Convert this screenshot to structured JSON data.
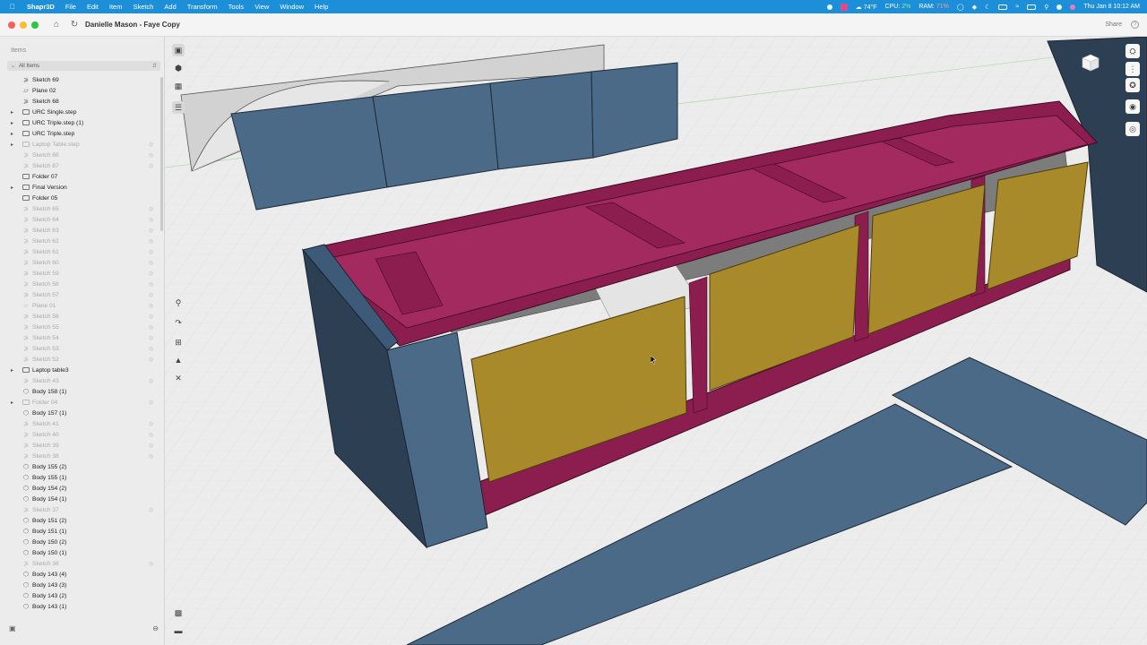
{
  "menubar": {
    "app_name": "Shapr3D",
    "menus": [
      "File",
      "Edit",
      "Item",
      "Sketch",
      "Add",
      "Transform",
      "Tools",
      "View",
      "Window",
      "Help"
    ],
    "weather": "74°F",
    "cpu_label": "CPU:",
    "ram_label": "RAM:",
    "cpu_value": "2%",
    "ram_value": "71%",
    "datetime": "Thu Jan 8  10:12 AM"
  },
  "titlebar": {
    "document": "Danielle Mason - Faye Copy",
    "share_label": "Share",
    "help_label": "?"
  },
  "sidebar": {
    "header": "Items",
    "all_items": "All Items",
    "items": [
      {
        "label": "Sketch 69",
        "kind": "sketch",
        "hidden": false,
        "expandable": false
      },
      {
        "label": "Plane 02",
        "kind": "plane",
        "hidden": false,
        "expandable": false
      },
      {
        "label": "Sketch 68",
        "kind": "sketch",
        "hidden": false,
        "expandable": false
      },
      {
        "label": "URC Single.step",
        "kind": "folder",
        "hidden": false,
        "expandable": true
      },
      {
        "label": "URC Triple.step (1)",
        "kind": "folder",
        "hidden": false,
        "expandable": true
      },
      {
        "label": "URC Triple.step",
        "kind": "folder",
        "hidden": false,
        "expandable": true
      },
      {
        "label": "Laptop Table.step",
        "kind": "folder",
        "hidden": true,
        "expandable": true
      },
      {
        "label": "Sketch 88",
        "kind": "sketch",
        "hidden": true,
        "expandable": false
      },
      {
        "label": "Sketch 87",
        "kind": "sketch",
        "hidden": true,
        "expandable": false
      },
      {
        "label": "Folder 07",
        "kind": "folder",
        "hidden": false,
        "expandable": false
      },
      {
        "label": "Final Version",
        "kind": "folder",
        "hidden": false,
        "expandable": true
      },
      {
        "label": "Folder 05",
        "kind": "folder",
        "hidden": false,
        "expandable": false
      },
      {
        "label": "Sketch 65",
        "kind": "sketch",
        "hidden": true,
        "expandable": false
      },
      {
        "label": "Sketch 64",
        "kind": "sketch",
        "hidden": true,
        "expandable": false
      },
      {
        "label": "Sketch 63",
        "kind": "sketch",
        "hidden": true,
        "expandable": false
      },
      {
        "label": "Sketch 62",
        "kind": "sketch",
        "hidden": true,
        "expandable": false
      },
      {
        "label": "Sketch 61",
        "kind": "sketch",
        "hidden": true,
        "expandable": false
      },
      {
        "label": "Sketch 60",
        "kind": "sketch",
        "hidden": true,
        "expandable": false
      },
      {
        "label": "Sketch 59",
        "kind": "sketch",
        "hidden": true,
        "expandable": false
      },
      {
        "label": "Sketch 58",
        "kind": "sketch",
        "hidden": true,
        "expandable": false
      },
      {
        "label": "Sketch 57",
        "kind": "sketch",
        "hidden": true,
        "expandable": false
      },
      {
        "label": "Plane 01",
        "kind": "plane",
        "hidden": true,
        "expandable": false
      },
      {
        "label": "Sketch 56",
        "kind": "sketch",
        "hidden": true,
        "expandable": false
      },
      {
        "label": "Sketch 55",
        "kind": "sketch",
        "hidden": true,
        "expandable": false
      },
      {
        "label": "Sketch 54",
        "kind": "sketch",
        "hidden": true,
        "expandable": false
      },
      {
        "label": "Sketch 53",
        "kind": "sketch",
        "hidden": true,
        "expandable": false
      },
      {
        "label": "Sketch 52",
        "kind": "sketch",
        "hidden": true,
        "expandable": false
      },
      {
        "label": "Laptop table3",
        "kind": "folder",
        "hidden": false,
        "expandable": true
      },
      {
        "label": "Sketch 43",
        "kind": "sketch",
        "hidden": true,
        "expandable": false
      },
      {
        "label": "Body 158 (1)",
        "kind": "body",
        "hidden": false,
        "expandable": false
      },
      {
        "label": "Folder 04",
        "kind": "folder",
        "hidden": true,
        "expandable": true
      },
      {
        "label": "Body 157 (1)",
        "kind": "body",
        "hidden": false,
        "expandable": false
      },
      {
        "label": "Sketch 41",
        "kind": "sketch",
        "hidden": true,
        "expandable": false
      },
      {
        "label": "Sketch 40",
        "kind": "sketch",
        "hidden": true,
        "expandable": false
      },
      {
        "label": "Sketch 39",
        "kind": "sketch",
        "hidden": true,
        "expandable": false
      },
      {
        "label": "Sketch 38",
        "kind": "sketch",
        "hidden": true,
        "expandable": false
      },
      {
        "label": "Body 155 (2)",
        "kind": "body",
        "hidden": false,
        "expandable": false
      },
      {
        "label": "Body 155 (1)",
        "kind": "body",
        "hidden": false,
        "expandable": false
      },
      {
        "label": "Body 154 (2)",
        "kind": "body",
        "hidden": false,
        "expandable": false
      },
      {
        "label": "Body 154 (1)",
        "kind": "body",
        "hidden": false,
        "expandable": false
      },
      {
        "label": "Sketch 37",
        "kind": "sketch",
        "hidden": true,
        "expandable": false
      },
      {
        "label": "Body 151 (2)",
        "kind": "body",
        "hidden": false,
        "expandable": false
      },
      {
        "label": "Body 151 (1)",
        "kind": "body",
        "hidden": false,
        "expandable": false
      },
      {
        "label": "Body 150 (2)",
        "kind": "body",
        "hidden": false,
        "expandable": false
      },
      {
        "label": "Body 150 (1)",
        "kind": "body",
        "hidden": false,
        "expandable": false
      },
      {
        "label": "Sketch 36",
        "kind": "sketch",
        "hidden": true,
        "expandable": false
      },
      {
        "label": "Body 143 (4)",
        "kind": "body",
        "hidden": false,
        "expandable": false
      },
      {
        "label": "Body 143 (3)",
        "kind": "body",
        "hidden": false,
        "expandable": false
      },
      {
        "label": "Body 143 (2)",
        "kind": "body",
        "hidden": false,
        "expandable": false
      },
      {
        "label": "Body 143 (1)",
        "kind": "body",
        "hidden": false,
        "expandable": false
      }
    ]
  },
  "colors": {
    "frame_magenta": "#8c1d4f",
    "panel_gold": "#a88a2a",
    "panel_blue": "#4a6a88",
    "panel_dark_blue": "#2d3f52",
    "menubar_blue": "#1d8fd8"
  }
}
